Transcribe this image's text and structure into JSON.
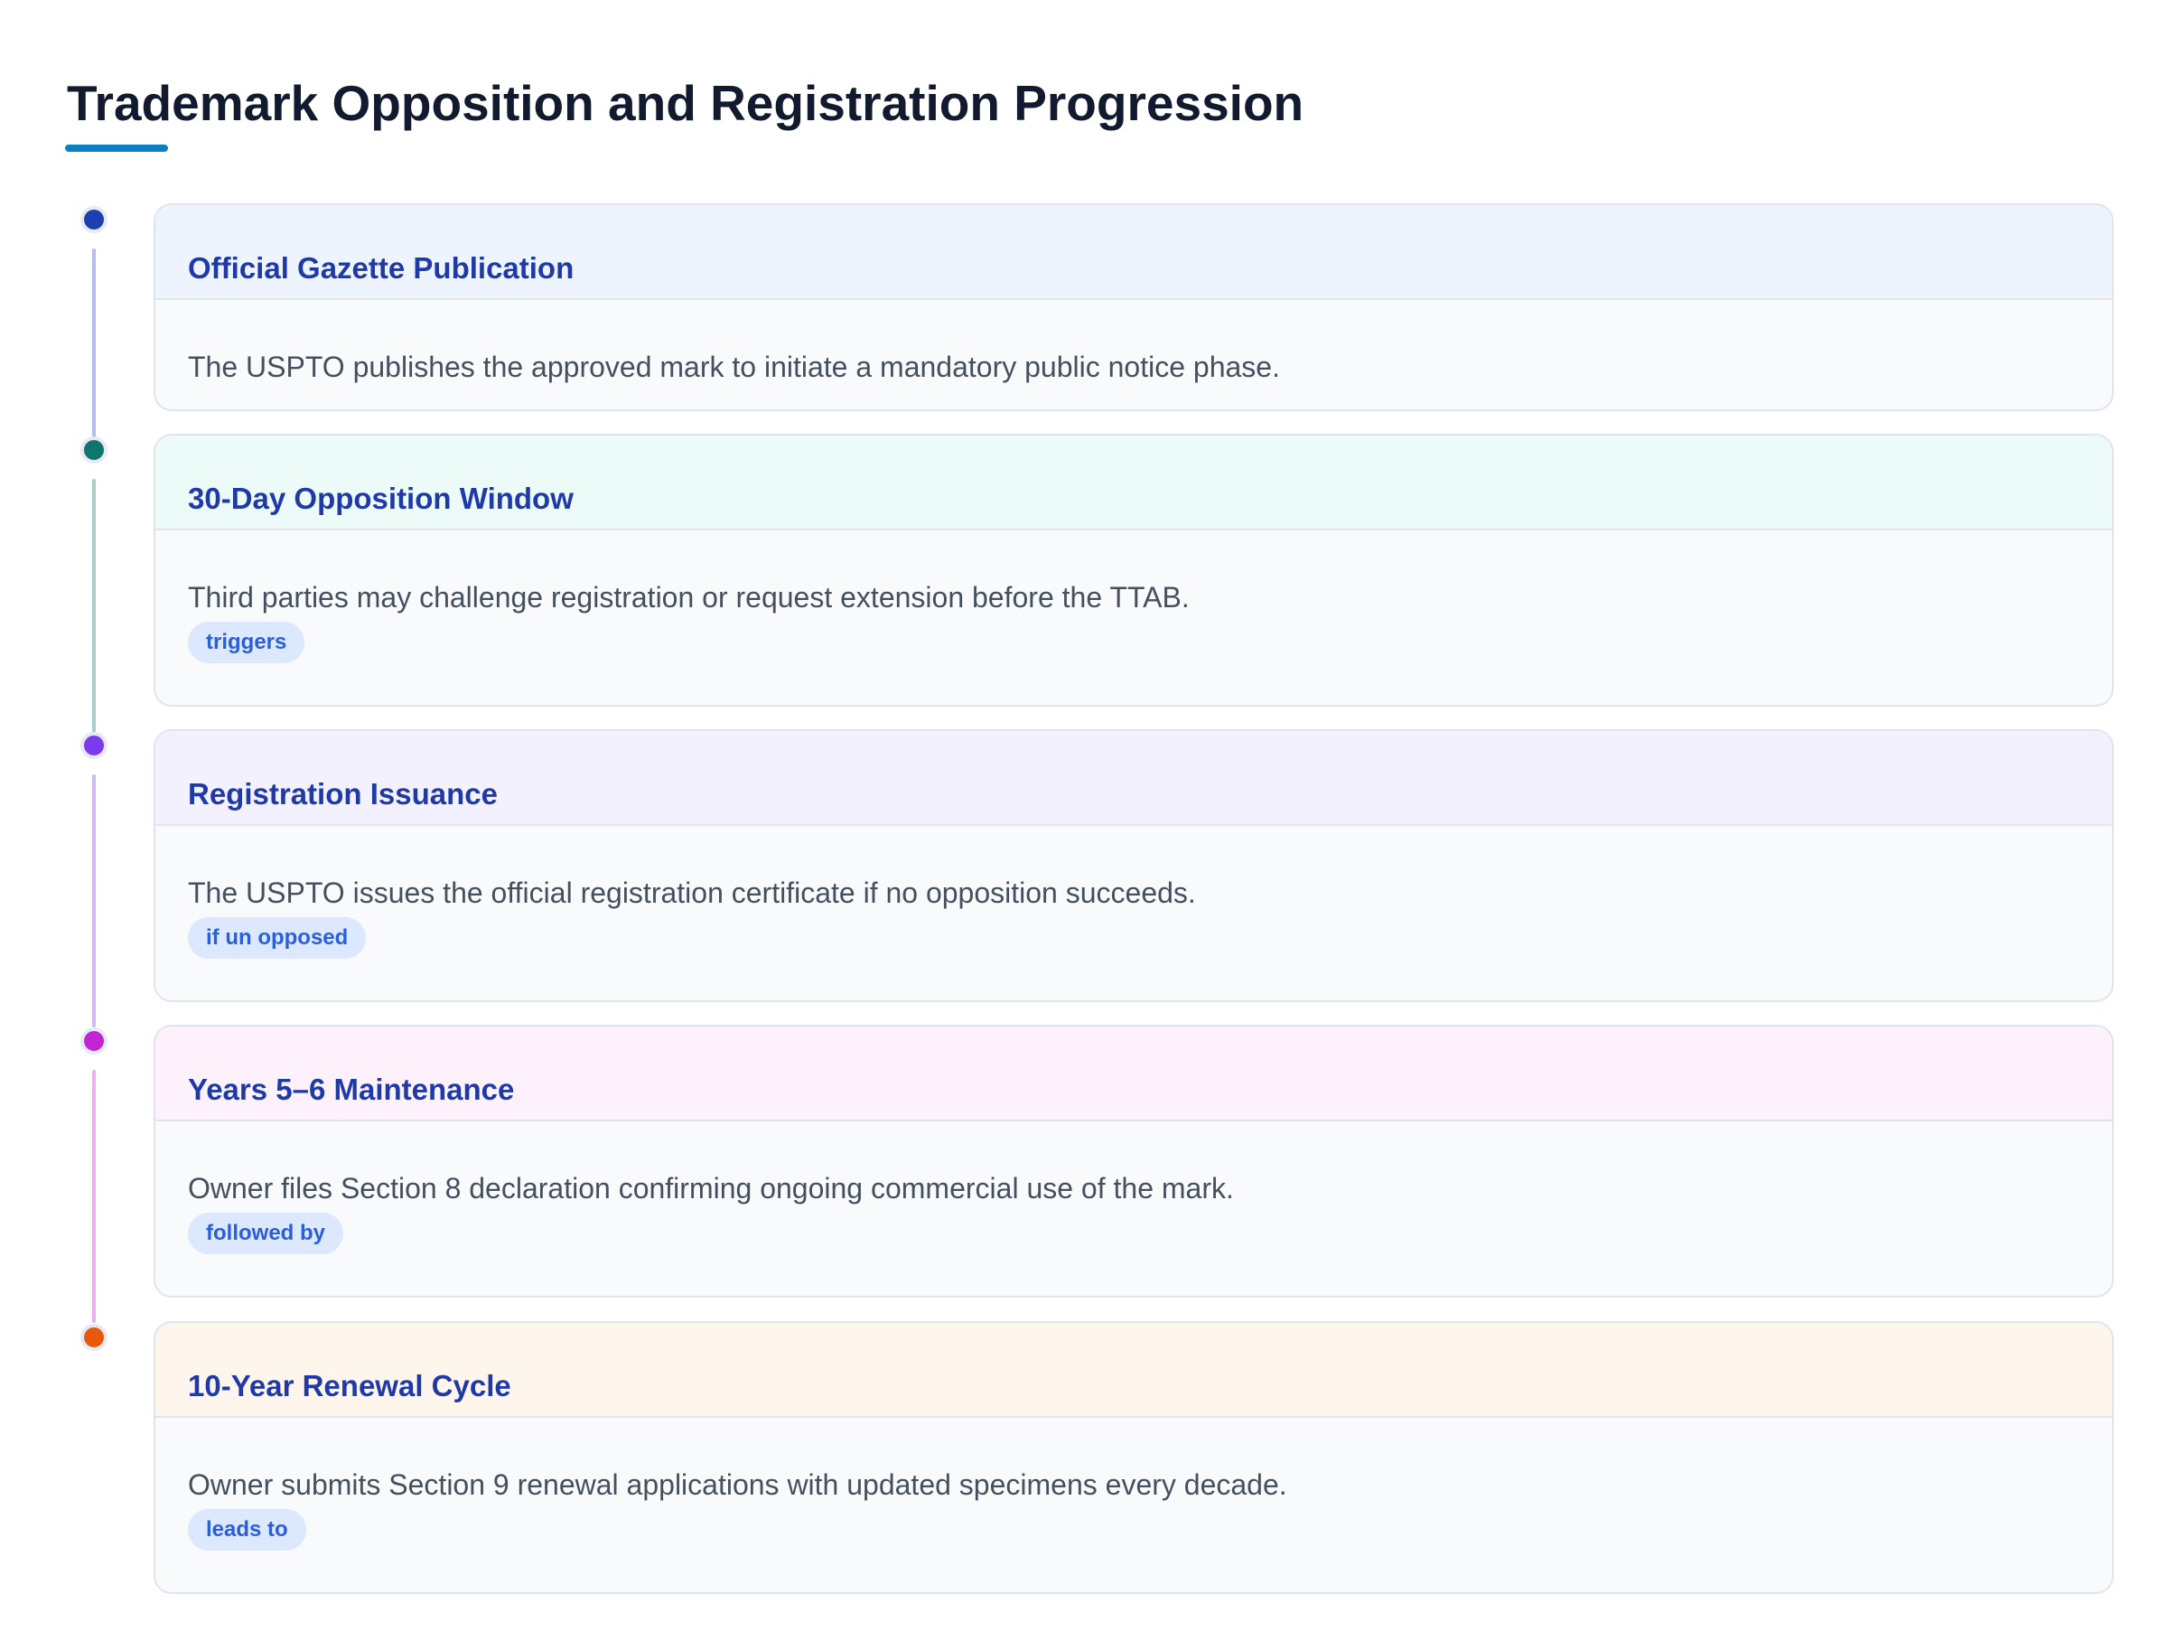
{
  "title": "Trademark Opposition and Registration Progression",
  "accent_color": "#0a7fc4",
  "steps": [
    {
      "title": "Official Gazette Publication",
      "description": "The USPTO publishes the approved mark to initiate a mandatory public notice phase.",
      "tag": "",
      "dot_color": "#1e40af",
      "line_color": "#b4bdf0",
      "header_bg": "#edf4fe"
    },
    {
      "title": "30-Day Opposition Window",
      "description": "Third parties may challenge registration or request extension before the TTAB.",
      "tag": "triggers",
      "dot_color": "#0f766e",
      "line_color": "#a9cfcb",
      "header_bg": "#ecfbf7"
    },
    {
      "title": "Registration Issuance",
      "description": "The USPTO issues the official registration certificate if no opposition succeeds.",
      "tag": "if un opposed",
      "dot_color": "#7c3aed",
      "line_color": "#d2b8f5",
      "header_bg": "#f3f1fd"
    },
    {
      "title": "Years 5–6 Maintenance",
      "description": "Owner files Section 8 declaration confirming ongoing commercial use of the mark.",
      "tag": "followed by",
      "dot_color": "#c026d3",
      "line_color": "#eab0ef",
      "header_bg": "#fdf1fc"
    },
    {
      "title": "10-Year Renewal Cycle",
      "description": "Owner submits Section 9 renewal applications with updated specimens every decade.",
      "tag": "leads to",
      "dot_color": "#ea580c",
      "line_color": "",
      "header_bg": "#fef5ec"
    }
  ]
}
